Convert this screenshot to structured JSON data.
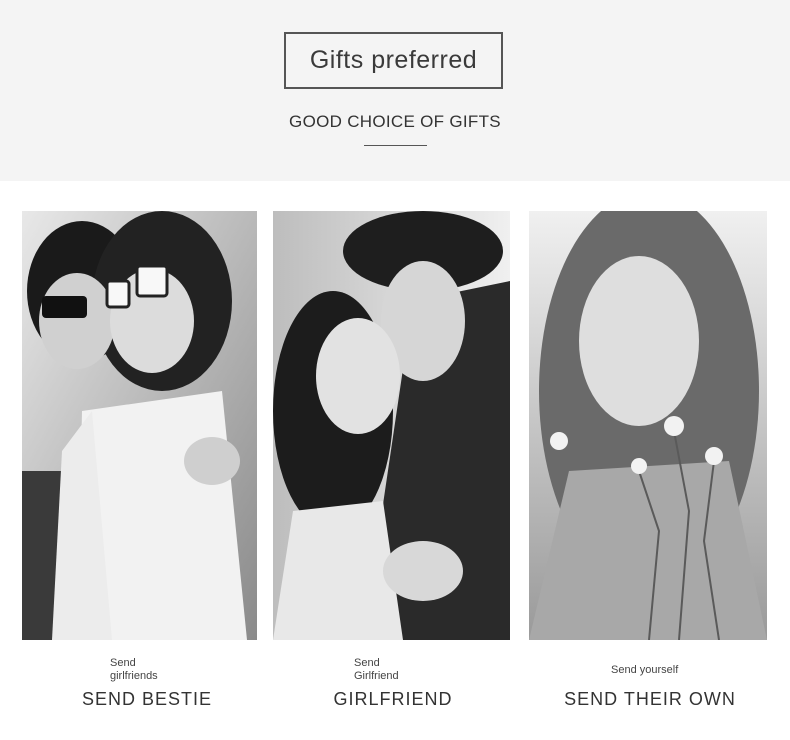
{
  "header": {
    "title": "Gifts preferred",
    "subtitle": "GOOD CHOICE OF GIFTS"
  },
  "cards": [
    {
      "image_icon": "friends-sunglasses-photo",
      "small_line1": "Send",
      "small_line2": "girlfriends",
      "caption": "SEND BESTIE"
    },
    {
      "image_icon": "couple-embrace-photo",
      "small_line1": "Send",
      "small_line2": "Girlfriend",
      "caption": "GIRLFRIEND"
    },
    {
      "image_icon": "woman-flowers-photo",
      "small_line1": "Send yourself",
      "small_line2": "",
      "caption": "SEND THEIR OWN"
    }
  ],
  "colors": {
    "header_bg": "#f4f4f4",
    "text": "#333333",
    "border": "#555555"
  }
}
